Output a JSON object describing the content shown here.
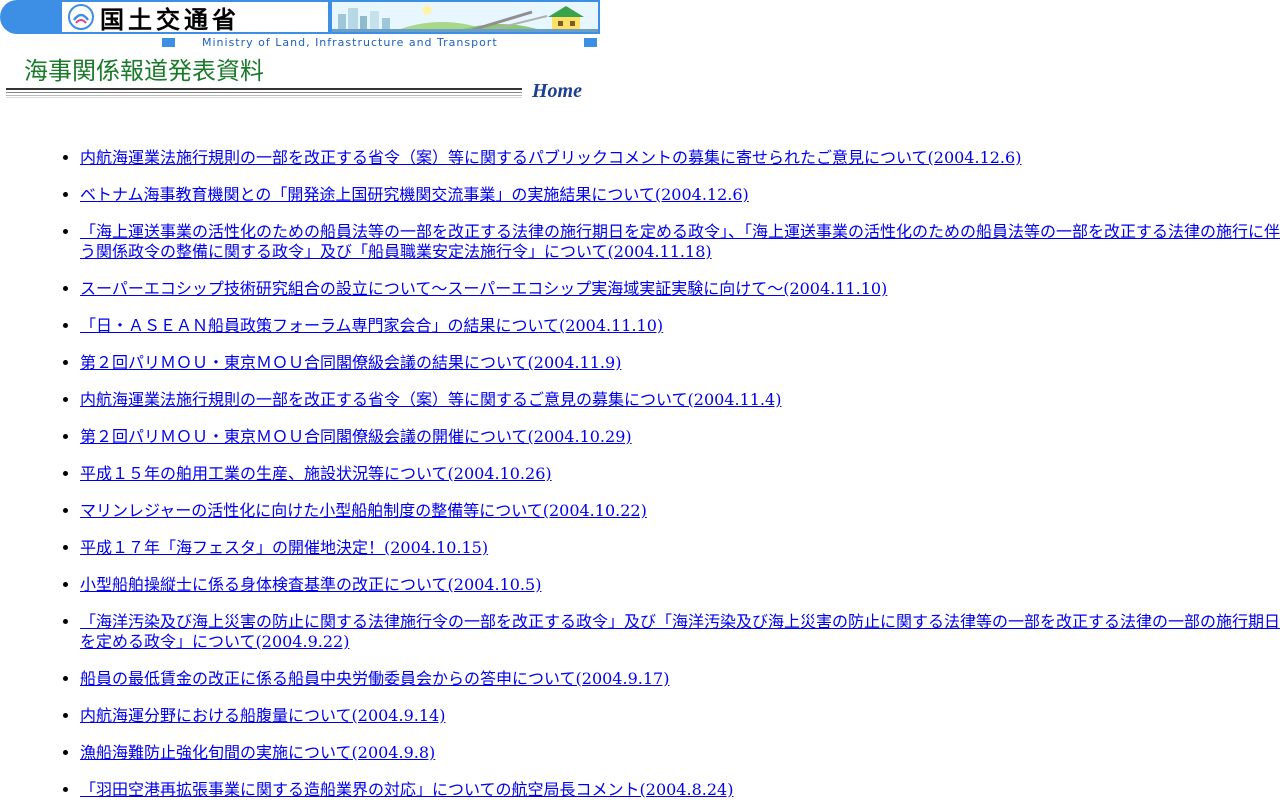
{
  "header": {
    "ministry_ja": "国土交通省",
    "ministry_en": "Ministry of Land, Infrastructure and Transport",
    "page_title": "海事関係報道発表資料",
    "home_label": "Home"
  },
  "colors": {
    "banner_blue": "#3d8fe6",
    "heading_green": "#1a7a2a",
    "link_blue": "#0000ee",
    "home_navy": "#1c3f94"
  },
  "news": [
    {
      "title": "内航海運業法施行規則の一部を改正する省令（案）等に関するパブリックコメントの募集に寄せられたご意見について(2004.12.6)"
    },
    {
      "title": "ベトナム海事教育機関との「開発途上国研究機関交流事業」の実施結果について(2004.12.6)"
    },
    {
      "title": "「海上運送事業の活性化のための船員法等の一部を改正する法律の施行期日を定める政令」、「海上運送事業の活性化のための船員法等の一部を改正する法律の施行に伴う関係政令の整備に関する政令」及び「船員職業安定法施行令」について(2004.11.18)"
    },
    {
      "title": "スーパーエコシップ技術研究組合の設立について～スーパーエコシップ実海域実証実験に向けて～(2004.11.10)"
    },
    {
      "title": "「日・ＡＳＥＡＮ船員政策フォーラム専門家会合」の結果について(2004.11.10)"
    },
    {
      "title": "第２回パリＭＯＵ・東京ＭＯＵ合同閣僚級会議の結果について(2004.11.9)"
    },
    {
      "title": "内航海運業法施行規則の一部を改正する省令（案）等に関するご意見の募集について(2004.11.4)"
    },
    {
      "title": "第２回パリＭＯＵ・東京ＭＯＵ合同閣僚級会議の開催について(2004.10.29)"
    },
    {
      "title": "平成１５年の舶用工業の生産、施設状況等について(2004.10.26)"
    },
    {
      "title": "マリンレジャーの活性化に向けた小型船舶制度の整備等について(2004.10.22)"
    },
    {
      "title": "平成１７年「海フェスタ」の開催地決定！(2004.10.15)"
    },
    {
      "title": "小型船舶操縦士に係る身体検査基準の改正について(2004.10.5)"
    },
    {
      "title": "「海洋汚染及び海上災害の防止に関する法律施行令の一部を改正する政令」及び「海洋汚染及び海上災害の防止に関する法律等の一部を改正する法律の一部の施行期日を定める政令」について(2004.9.22)"
    },
    {
      "title": "船員の最低賃金の改正に係る船員中央労働委員会からの答申について(2004.9.17)"
    },
    {
      "title": "内航海運分野における船腹量について(2004.9.14)"
    },
    {
      "title": "漁船海難防止強化旬間の実施について(2004.9.8)"
    },
    {
      "title": "「羽田空港再拡張事業に関する造船業界の対応」についての航空局長コメント(2004.8.24)"
    }
  ]
}
